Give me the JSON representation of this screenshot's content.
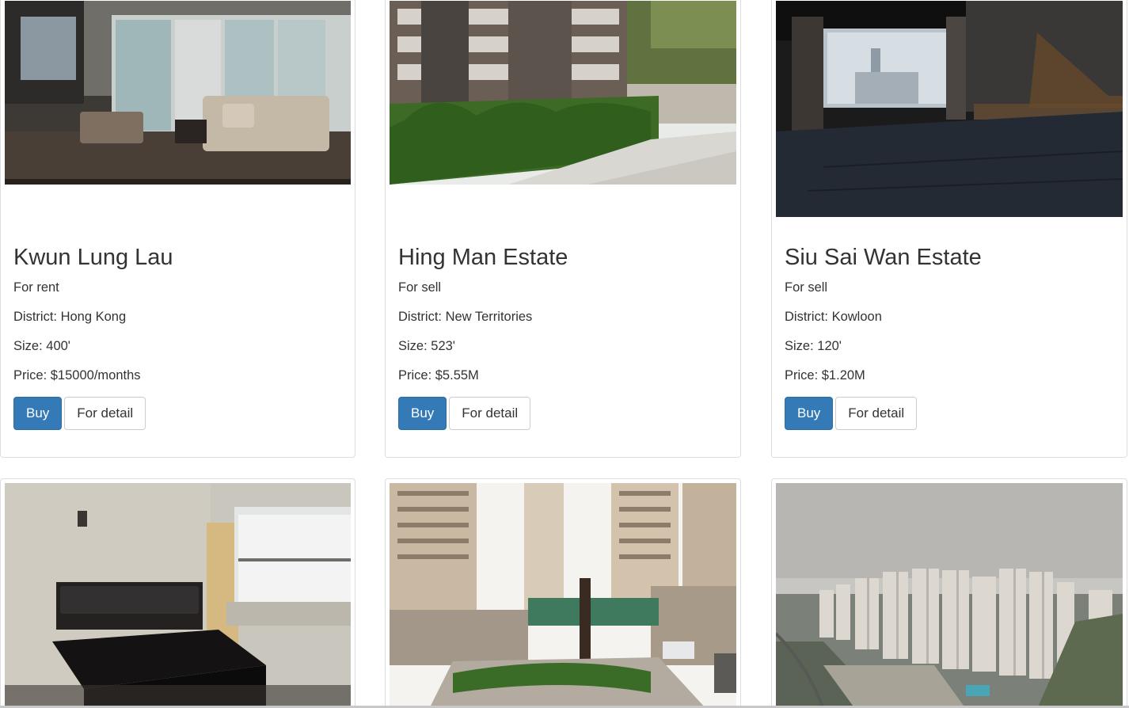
{
  "listings": [
    {
      "name": "Kwun Lung Lau",
      "type": "For rent",
      "district": "District: Hong Kong",
      "size": "Size: 400'",
      "price": "Price: $15000/months",
      "buy_label": "Buy",
      "detail_label": "For detail",
      "photo": "living-room-photo"
    },
    {
      "name": "Hing Man Estate",
      "type": "For sell",
      "district": "District: New Territories",
      "size": "Size: 523'",
      "price": "Price: $5.55M",
      "buy_label": "Buy",
      "detail_label": "For detail",
      "photo": "estate-garden-photo"
    },
    {
      "name": "Siu Sai Wan Estate",
      "type": "For sell",
      "district": "District: Kowloon",
      "size": "Size: 120'",
      "price": "Price: $1.20M",
      "buy_label": "Buy",
      "detail_label": "For detail",
      "photo": "empty-room-photo"
    },
    {
      "photo": "bedroom-photo"
    },
    {
      "photo": "estate-courtyard-photo"
    },
    {
      "photo": "skyline-photo"
    }
  ],
  "colors": {
    "primary_button": "#337ab7",
    "card_border": "#dddddd",
    "text": "#333333"
  }
}
